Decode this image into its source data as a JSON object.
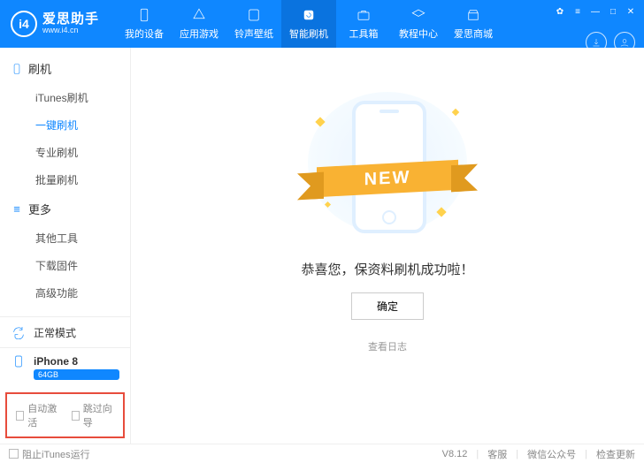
{
  "app": {
    "name": "爱思助手",
    "domain": "www.i4.cn",
    "logo_text": "i4"
  },
  "nav": [
    {
      "label": "我的设备"
    },
    {
      "label": "应用游戏"
    },
    {
      "label": "铃声壁纸"
    },
    {
      "label": "智能刷机",
      "active": true
    },
    {
      "label": "工具箱"
    },
    {
      "label": "教程中心"
    },
    {
      "label": "爱思商城"
    }
  ],
  "sidebar": {
    "groups": [
      {
        "title": "刷机",
        "items": [
          {
            "label": "iTunes刷机"
          },
          {
            "label": "一键刷机",
            "active": true
          },
          {
            "label": "专业刷机"
          },
          {
            "label": "批量刷机"
          }
        ]
      },
      {
        "title": "更多",
        "items": [
          {
            "label": "其他工具"
          },
          {
            "label": "下载固件"
          },
          {
            "label": "高级功能"
          }
        ]
      }
    ],
    "mode": "正常模式",
    "device": "iPhone 8",
    "storage": "64GB",
    "auto_activate": "自动激活",
    "skip_guide": "跳过向导"
  },
  "main": {
    "success": "恭喜您，保资料刷机成功啦！",
    "confirm": "确定",
    "view_log": "查看日志",
    "ribbon": "NEW"
  },
  "footer": {
    "block_itunes": "阻止iTunes运行",
    "version": "V8.12",
    "support": "客服",
    "wechat": "微信公众号",
    "update": "检查更新"
  }
}
